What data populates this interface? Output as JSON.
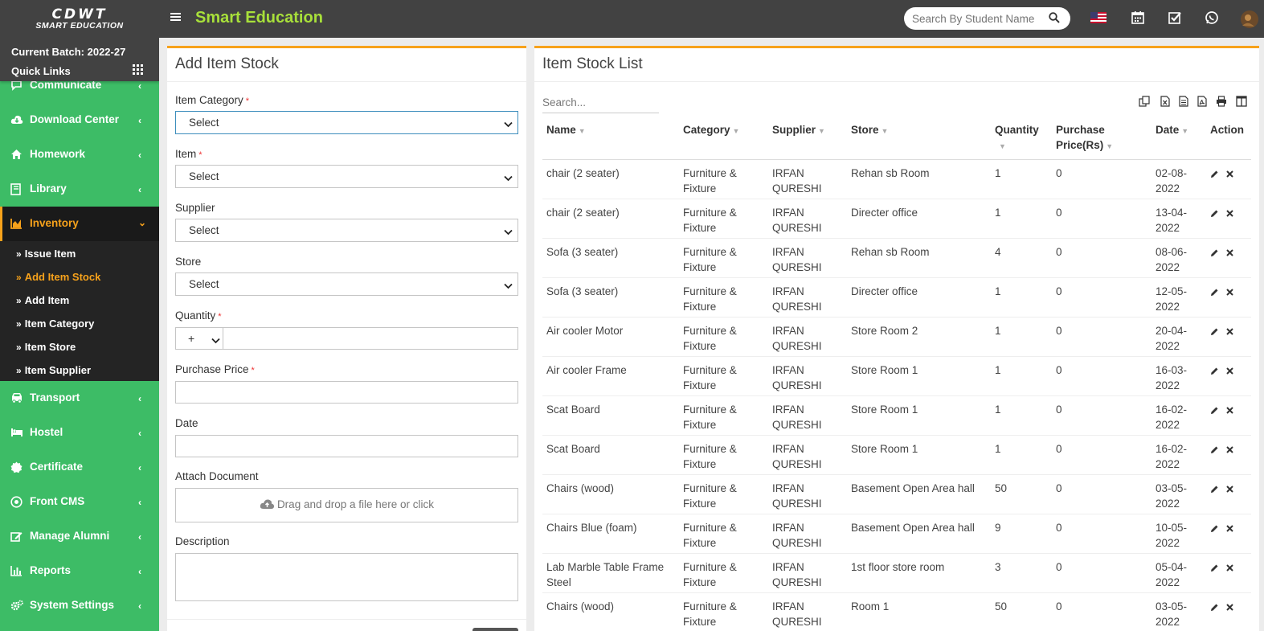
{
  "header": {
    "logo_line1": "CDWT",
    "logo_line2": "SMART EDUCATION",
    "app_title": "Smart Education",
    "search_placeholder": "Search By Student Name",
    "icons": [
      "menu-icon",
      "search-icon",
      "us-flag-icon",
      "calendar-icon",
      "checkbox-icon",
      "whatsapp-icon",
      "user-avatar"
    ]
  },
  "sidebar": {
    "batch": "Current Batch: 2022-27",
    "quick_links": "Quick Links",
    "items": [
      {
        "label": "Communicate",
        "icon": "chat-icon"
      },
      {
        "label": "Download Center",
        "icon": "cloud-download-icon"
      },
      {
        "label": "Homework",
        "icon": "home-icon"
      },
      {
        "label": "Library",
        "icon": "book-icon"
      },
      {
        "label": "Inventory",
        "icon": "chart-icon",
        "active": true
      },
      {
        "label": "Transport",
        "icon": "bus-icon"
      },
      {
        "label": "Hostel",
        "icon": "bed-icon"
      },
      {
        "label": "Certificate",
        "icon": "certificate-icon"
      },
      {
        "label": "Front CMS",
        "icon": "cms-icon"
      },
      {
        "label": "Manage Alumni",
        "icon": "edit-icon"
      },
      {
        "label": "Reports",
        "icon": "bar-chart-icon"
      },
      {
        "label": "System Settings",
        "icon": "cogs-icon"
      }
    ],
    "submenu": [
      {
        "label": "Issue Item"
      },
      {
        "label": "Add Item Stock",
        "active": true
      },
      {
        "label": "Add Item"
      },
      {
        "label": "Item Category"
      },
      {
        "label": "Item Store"
      },
      {
        "label": "Item Supplier"
      }
    ]
  },
  "form": {
    "title": "Add Item Stock",
    "item_category_label": "Item Category",
    "item_label": "Item",
    "supplier_label": "Supplier",
    "store_label": "Store",
    "quantity_label": "Quantity",
    "purchase_price_label": "Purchase Price",
    "date_label": "Date",
    "attach_label": "Attach Document",
    "description_label": "Description",
    "select_value": "Select",
    "quantity_sign": "+",
    "required_mark": "*",
    "dropzone_text": "Drag and drop a file here or click"
  },
  "list": {
    "title": "Item Stock List",
    "search_placeholder": "Search...",
    "toolbar_icons": [
      "copy-icon",
      "excel-icon",
      "csv-icon",
      "pdf-icon",
      "print-icon",
      "columns-icon"
    ],
    "columns": [
      "Name",
      "Category",
      "Supplier",
      "Store",
      "Quantity",
      "Purchase Price(Rs)",
      "Date",
      "Action"
    ],
    "rows": [
      {
        "name": "chair (2 seater)",
        "category": "Furniture & Fixture",
        "supplier": "IRFAN QURESHI",
        "store": "Rehan sb Room",
        "quantity": "1",
        "price": "0",
        "date": "02-08-2022"
      },
      {
        "name": "chair (2 seater)",
        "category": "Furniture & Fixture",
        "supplier": "IRFAN QURESHI",
        "store": "Directer office",
        "quantity": "1",
        "price": "0",
        "date": "13-04-2022"
      },
      {
        "name": "Sofa (3 seater)",
        "category": "Furniture & Fixture",
        "supplier": "IRFAN QURESHI",
        "store": "Rehan sb Room",
        "quantity": "4",
        "price": "0",
        "date": "08-06-2022"
      },
      {
        "name": "Sofa (3 seater)",
        "category": "Furniture & Fixture",
        "supplier": "IRFAN QURESHI",
        "store": "Directer office",
        "quantity": "1",
        "price": "0",
        "date": "12-05-2022"
      },
      {
        "name": "Air cooler Motor",
        "category": "Furniture & Fixture",
        "supplier": "IRFAN QURESHI",
        "store": "Store Room 2",
        "quantity": "1",
        "price": "0",
        "date": "20-04-2022"
      },
      {
        "name": "Air cooler Frame",
        "category": "Furniture & Fixture",
        "supplier": "IRFAN QURESHI",
        "store": "Store Room 1",
        "quantity": "1",
        "price": "0",
        "date": "16-03-2022"
      },
      {
        "name": "Scat Board",
        "category": "Furniture & Fixture",
        "supplier": "IRFAN QURESHI",
        "store": "Store Room 1",
        "quantity": "1",
        "price": "0",
        "date": "16-02-2022"
      },
      {
        "name": "Scat Board",
        "category": "Furniture & Fixture",
        "supplier": "IRFAN QURESHI",
        "store": "Store Room 1",
        "quantity": "1",
        "price": "0",
        "date": "16-02-2022"
      },
      {
        "name": "Chairs (wood)",
        "category": "Furniture & Fixture",
        "supplier": "IRFAN QURESHI",
        "store": "Basement Open Area hall",
        "quantity": "50",
        "price": "0",
        "date": "03-05-2022"
      },
      {
        "name": "Chairs Blue (foam)",
        "category": "Furniture & Fixture",
        "supplier": "IRFAN QURESHI",
        "store": "Basement Open Area hall",
        "quantity": "9",
        "price": "0",
        "date": "10-05-2022"
      },
      {
        "name": "Lab Marble Table Frame Steel",
        "category": "Furniture & Fixture",
        "supplier": "IRFAN QURESHI",
        "store": "1st floor store room",
        "quantity": "3",
        "price": "0",
        "date": "05-04-2022"
      },
      {
        "name": "Chairs (wood)",
        "category": "Furniture & Fixture",
        "supplier": "IRFAN QURESHI",
        "store": "Room 1",
        "quantity": "50",
        "price": "0",
        "date": "03-05-2022"
      }
    ]
  },
  "colors": {
    "header_bg": "#424242",
    "sidebar_bg": "#3dbc66",
    "accent": "#f7a21b",
    "title_green": "#a8e03a"
  }
}
